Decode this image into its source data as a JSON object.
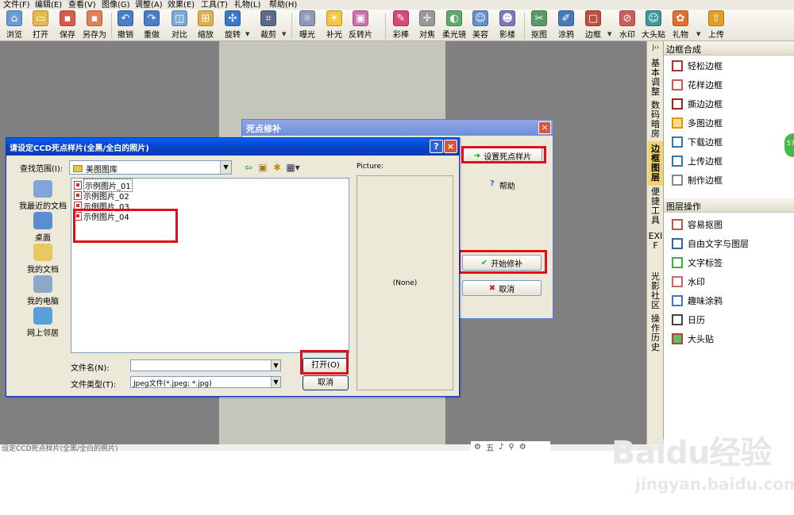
{
  "menu": [
    "文件(F)",
    "编辑(E)",
    "查看(V)",
    "图像(G)",
    "调整(A)",
    "效果(E)",
    "工具(T)",
    "礼物(L)",
    "帮助(H)"
  ],
  "toolbar": [
    {
      "label": "浏览",
      "icon": "browse-icon"
    },
    {
      "label": "打开",
      "icon": "open-folder-icon"
    },
    {
      "label": "保存",
      "icon": "save-icon"
    },
    {
      "label": "另存为",
      "icon": "save-as-icon"
    },
    {
      "label": "撤销",
      "icon": "undo-icon"
    },
    {
      "label": "重做",
      "icon": "redo-icon"
    },
    {
      "label": "对比",
      "icon": "compare-icon"
    },
    {
      "label": "缩放",
      "icon": "zoom-icon"
    },
    {
      "label": "旋转",
      "icon": "rotate-icon"
    },
    {
      "label": "裁剪",
      "icon": "crop-icon"
    },
    {
      "label": "曝光",
      "icon": "exposure-icon"
    },
    {
      "label": "补光",
      "icon": "fill-light-icon"
    },
    {
      "label": "反转片",
      "icon": "reversal-film-icon"
    },
    {
      "label": "彩棒",
      "icon": "color-wand-icon"
    },
    {
      "label": "对焦",
      "icon": "focus-icon"
    },
    {
      "label": "柔光镜",
      "icon": "soft-light-icon"
    },
    {
      "label": "美容",
      "icon": "beauty-icon"
    },
    {
      "label": "影楼",
      "icon": "studio-icon"
    },
    {
      "label": "抠图",
      "icon": "cutout-icon"
    },
    {
      "label": "涂鸦",
      "icon": "doodle-icon"
    },
    {
      "label": "边框",
      "icon": "frame-icon"
    },
    {
      "label": "水印",
      "icon": "watermark-icon"
    },
    {
      "label": "大头贴",
      "icon": "photo-sticker-icon"
    },
    {
      "label": "礼物",
      "icon": "gift-icon"
    },
    {
      "label": "上传",
      "icon": "upload-icon"
    }
  ],
  "vtabs": [
    {
      "label": "基本调整"
    },
    {
      "label": "数码暗房"
    },
    {
      "label": "边框图层",
      "active": true
    },
    {
      "label": "便捷工具"
    },
    {
      "label": "EXIF"
    },
    {
      "label": "光影社区"
    },
    {
      "label": "操作历史"
    }
  ],
  "rpanel": {
    "section1": {
      "title": "边框合成",
      "items": [
        "轻松边框",
        "花样边框",
        "撕边边框",
        "多图边框",
        "下载边框",
        "上传边框",
        "制作边框"
      ]
    },
    "section2": {
      "title": "图层操作",
      "items": [
        "容易抠图",
        "自由文字与图层",
        "文字标签",
        "水印",
        "趣味涂鸦",
        "日历",
        "大头贴"
      ]
    }
  },
  "dead_pixel_dialog": {
    "title": "死点修补",
    "close": "×",
    "set_sample": "设置死点样片",
    "help": "帮助",
    "start_repair": "开始修补",
    "cancel": "取消"
  },
  "file_dialog": {
    "title": "请设定CCD死点样片(全黑/全白的照片)",
    "help_btn": "?",
    "close_btn": "×",
    "look_in_label": "查找范围(I):",
    "look_in_value": "美图图库",
    "places": [
      "我最近的文档",
      "桌面",
      "我的文档",
      "我的电脑",
      "网上邻居"
    ],
    "files": [
      "示例图片_01",
      "示例图片_02",
      "示例图片_03",
      "示例图片_04"
    ],
    "picture_label": "Picture:",
    "picture_value": "(None)",
    "filename_label": "文件名(N):",
    "filename_value": "",
    "filetype_label": "文件类型(T):",
    "filetype_value": "Jpeg文件(*.jpeg; *.jpg)",
    "open_btn": "打开(O)",
    "cancel_btn": "取消"
  },
  "status_text": "设定CCD死点样片(全黑/全白的照片)",
  "mini_tools": [
    "⚙",
    "五",
    "♪",
    "⚲",
    "⚙"
  ],
  "watermark": {
    "logo": "Baidu经验",
    "url": "jingyan.baidu.com"
  },
  "colors": {
    "highlight": "#e0101a",
    "xp_title": "#0a5ff0",
    "work_area": "#808080"
  }
}
